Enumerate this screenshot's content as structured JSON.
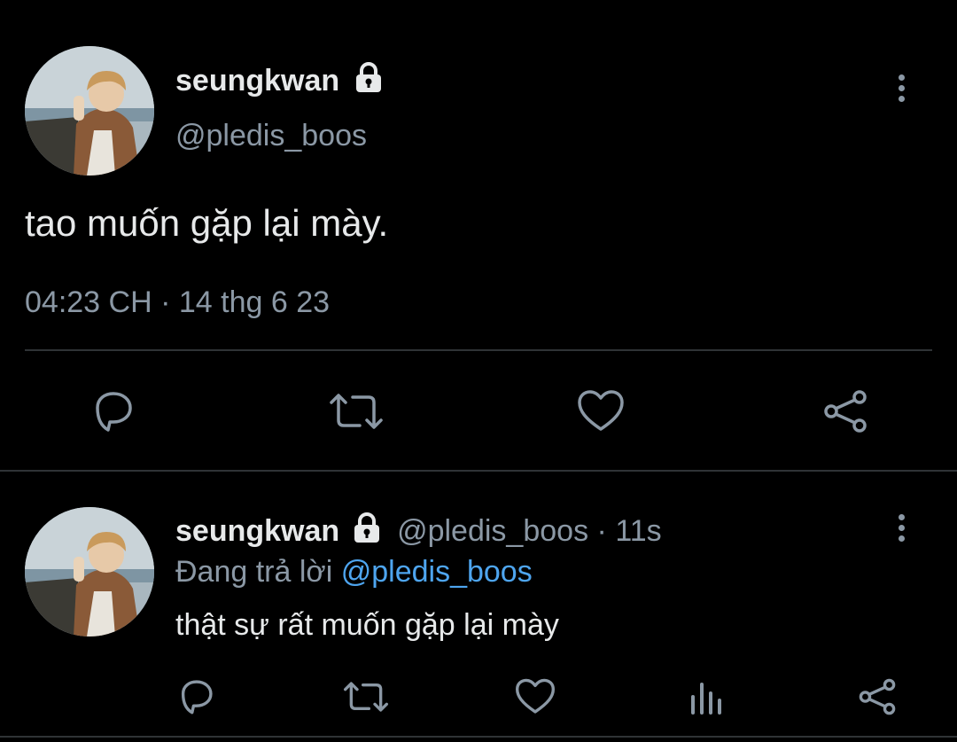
{
  "tweet": {
    "name": "seungkwan",
    "handle": "@pledis_boos",
    "text": "tao muốn gặp lại mày.",
    "time": "04:23 CH",
    "separator": "·",
    "date": "14 thg 6 23",
    "actions": [
      "reply-icon",
      "retweet-icon",
      "like-icon",
      "share-icon"
    ]
  },
  "reply": {
    "name": "seungkwan",
    "handle": "@pledis_boos",
    "separator": "·",
    "age": "11s",
    "replying_prefix": "Đang trả lời",
    "replying_to": "@pledis_boos",
    "text": "thật sự rất muốn gặp lại mày",
    "actions": [
      "reply-icon",
      "retweet-icon",
      "like-icon",
      "analytics-icon",
      "share-icon"
    ]
  },
  "colors": {
    "background": "#000000",
    "text": "#e7e9ea",
    "muted": "#8b98a5",
    "link": "#4ea5ef",
    "divider": "#2f3336"
  }
}
